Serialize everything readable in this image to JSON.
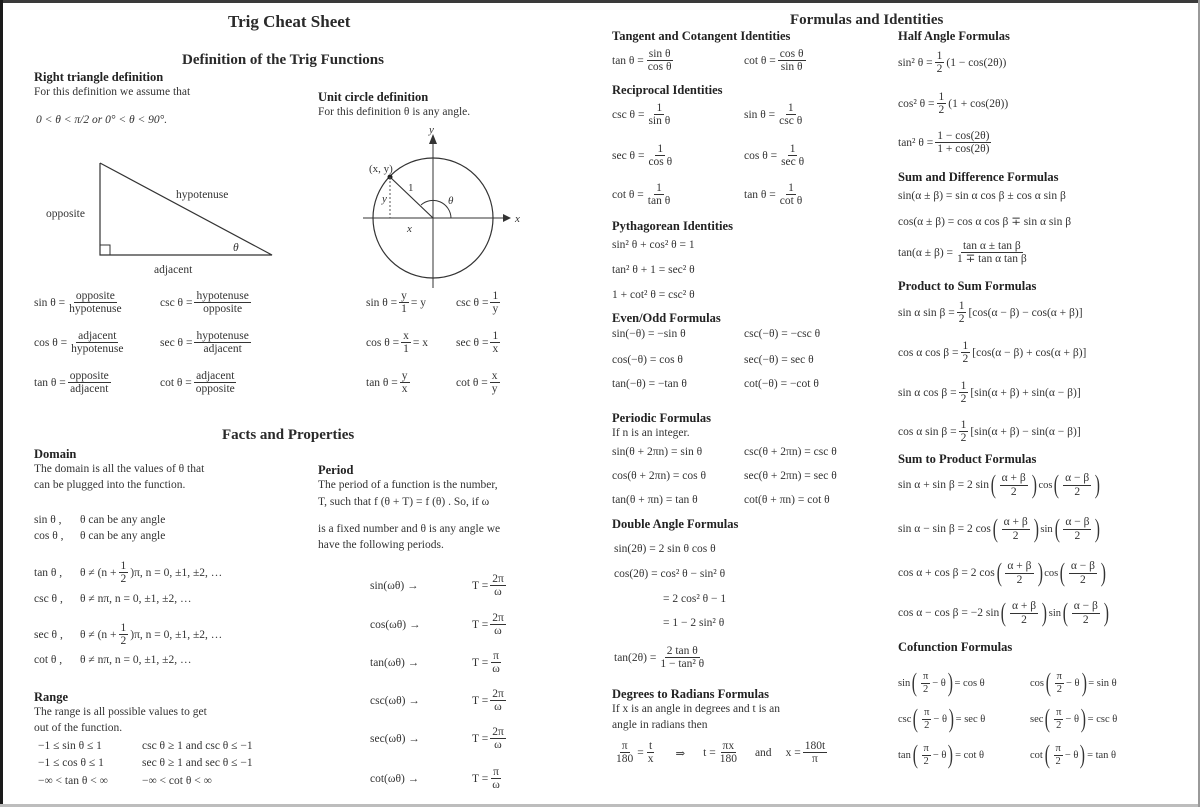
{
  "page": {
    "title": "Trig Cheat Sheet",
    "right_title": "Formulas and Identities"
  },
  "definitions": {
    "heading": "Definition of the Trig Functions",
    "right_triangle": {
      "heading": "Right triangle definition",
      "intro": "For this definition we assume that",
      "assumption": "0 < θ < π/2 or 0° < θ < 90°.",
      "labels": {
        "hypotenuse": "hypotenuse",
        "opposite": "opposite",
        "adjacent": "adjacent",
        "theta": "θ"
      },
      "formulas": [
        {
          "lhs": "sin θ =",
          "num": "opposite",
          "den": "hypotenuse"
        },
        {
          "lhs": "csc θ =",
          "num": "hypotenuse",
          "den": "opposite"
        },
        {
          "lhs": "cos θ =",
          "num": "adjacent",
          "den": "hypotenuse"
        },
        {
          "lhs": "sec θ =",
          "num": "hypotenuse",
          "den": "adjacent"
        },
        {
          "lhs": "tan θ =",
          "num": "opposite",
          "den": "adjacent"
        },
        {
          "lhs": "cot θ =",
          "num": "adjacent",
          "den": "opposite"
        }
      ]
    },
    "unit_circle": {
      "heading": "Unit circle definition",
      "intro": "For this definition θ is any angle.",
      "labels": {
        "point": "(x, y)",
        "radius": "1",
        "x": "x",
        "y": "y",
        "theta": "θ"
      },
      "formulas": [
        {
          "lhs": "sin θ =",
          "num": "y",
          "den": "1",
          "tail": "= y"
        },
        {
          "lhs": "csc θ =",
          "num": "1",
          "den": "y",
          "tail": ""
        },
        {
          "lhs": "cos θ =",
          "num": "x",
          "den": "1",
          "tail": "= x"
        },
        {
          "lhs": "sec θ =",
          "num": "1",
          "den": "x",
          "tail": ""
        },
        {
          "lhs": "tan θ =",
          "num": "y",
          "den": "x",
          "tail": ""
        },
        {
          "lhs": "cot θ =",
          "num": "x",
          "den": "y",
          "tail": ""
        }
      ]
    }
  },
  "facts": {
    "heading": "Facts and Properties",
    "domain": {
      "heading": "Domain",
      "text1": "The domain is all the values of θ that",
      "text2": "can be plugged into the function.",
      "rows": [
        {
          "fn": "sin θ ,",
          "cond": "θ can be any angle"
        },
        {
          "fn": "cos θ ,",
          "cond": "θ can be any angle"
        },
        {
          "fn": "tan θ ,",
          "cond_pre": "θ ≠ (n + ",
          "cond_num": "1",
          "cond_den": "2",
          "cond_post": ")π,  n = 0, ±1, ±2, …"
        },
        {
          "fn": "csc θ ,",
          "cond": "θ ≠ nπ,  n = 0, ±1, ±2, …"
        },
        {
          "fn": "sec θ ,",
          "cond_pre": "θ ≠ (n + ",
          "cond_num": "1",
          "cond_den": "2",
          "cond_post": ")π,  n = 0, ±1, ±2, …"
        },
        {
          "fn": "cot θ ,",
          "cond": "θ ≠ nπ,  n = 0, ±1, ±2, …"
        }
      ]
    },
    "range": {
      "heading": "Range",
      "text1": "The range is all possible values to get",
      "text2": "out of the function.",
      "rows": [
        {
          "a": "−1 ≤ sin θ ≤ 1",
          "b": "csc θ ≥ 1 and csc θ ≤ −1"
        },
        {
          "a": "−1 ≤ cos θ ≤ 1",
          "b": "sec θ ≥ 1 and sec θ ≤ −1"
        },
        {
          "a": "−∞ < tan θ < ∞",
          "b": "−∞ < cot θ < ∞"
        }
      ]
    },
    "period": {
      "heading": "Period",
      "text1": "The period of a function is the number,",
      "text2": "T, such that f (θ + T) = f (θ) .  So, if ω",
      "text3": "is a fixed number and θ is any angle we",
      "text4": "have the following periods.",
      "rows": [
        {
          "fn": "sin(ωθ)  →",
          "lhs": "T =",
          "num": "2π",
          "den": "ω"
        },
        {
          "fn": "cos(ωθ)  →",
          "lhs": "T =",
          "num": "2π",
          "den": "ω"
        },
        {
          "fn": "tan(ωθ)  →",
          "lhs": "T =",
          "num": "π",
          "den": "ω"
        },
        {
          "fn": "csc(ωθ)  →",
          "lhs": "T =",
          "num": "2π",
          "den": "ω"
        },
        {
          "fn": "sec(ωθ)  →",
          "lhs": "T =",
          "num": "2π",
          "den": "ω"
        },
        {
          "fn": "cot(ωθ)  →",
          "lhs": "T =",
          "num": "π",
          "den": "ω"
        }
      ]
    }
  },
  "identities": {
    "tan_cot": {
      "heading": "Tangent and Cotangent Identities",
      "items": [
        {
          "lhs": "tan θ =",
          "num": "sin θ",
          "den": "cos θ"
        },
        {
          "lhs": "cot θ =",
          "num": "cos θ",
          "den": "sin θ"
        }
      ]
    },
    "reciprocal": {
      "heading": "Reciprocal Identities",
      "items": [
        {
          "lhs": "csc θ =",
          "num": "1",
          "den": "sin θ"
        },
        {
          "lhs": "sin θ =",
          "num": "1",
          "den": "csc θ"
        },
        {
          "lhs": "sec θ =",
          "num": "1",
          "den": "cos θ"
        },
        {
          "lhs": "cos θ =",
          "num": "1",
          "den": "sec θ"
        },
        {
          "lhs": "cot θ =",
          "num": "1",
          "den": "tan θ"
        },
        {
          "lhs": "tan θ =",
          "num": "1",
          "den": "cot θ"
        }
      ]
    },
    "pythagorean": {
      "heading": "Pythagorean Identities",
      "items": [
        "sin² θ + cos² θ = 1",
        "tan² θ + 1 = sec² θ",
        "1 + cot² θ = csc² θ"
      ]
    },
    "even_odd": {
      "heading": "Even/Odd Formulas",
      "items": [
        "sin(−θ) = −sin θ",
        "csc(−θ) = −csc θ",
        "cos(−θ) = cos θ",
        "sec(−θ) = sec θ",
        "tan(−θ) = −tan θ",
        "cot(−θ) = −cot θ"
      ]
    },
    "periodic": {
      "heading": "Periodic Formulas",
      "intro": "If n is an integer.",
      "items": [
        "sin(θ + 2πn) = sin θ",
        "csc(θ + 2πn) = csc θ",
        "cos(θ + 2πn) = cos θ",
        "sec(θ + 2πn) = sec θ",
        "tan(θ + πn) = tan θ",
        "cot(θ + πn) = cot θ"
      ]
    },
    "double_angle": {
      "heading": "Double Angle Formulas",
      "items": [
        "sin(2θ) = 2 sin θ cos θ",
        "cos(2θ) = cos² θ − sin² θ",
        "= 2 cos² θ − 1",
        "= 1 − 2 sin² θ"
      ],
      "tan": {
        "lhs": "tan(2θ) =",
        "num": "2 tan θ",
        "den": "1 − tan² θ"
      }
    },
    "deg_rad": {
      "heading": "Degrees to Radians Formulas",
      "text1": "If x is an angle in degrees and t is an",
      "text2": "angle in radians then",
      "f1": {
        "num": "π",
        "den": "180"
      },
      "eq": "=",
      "f2": {
        "num": "t",
        "den": "x"
      },
      "implies": "⇒",
      "t_lhs": "t =",
      "f3": {
        "num": "πx",
        "den": "180"
      },
      "and": "and",
      "x_lhs": "x =",
      "f4": {
        "num": "180t",
        "den": "π"
      }
    },
    "half_angle": {
      "heading": "Half Angle Formulas",
      "items": [
        {
          "lhs": "sin² θ =",
          "num": "1",
          "den": "2",
          "tail": "(1 − cos(2θ))"
        },
        {
          "lhs": "cos² θ =",
          "num": "1",
          "den": "2",
          "tail": "(1 + cos(2θ))"
        }
      ],
      "tan": {
        "lhs": "tan² θ =",
        "num": "1 − cos(2θ)",
        "den": "1 + cos(2θ)"
      }
    },
    "sum_diff": {
      "heading": "Sum and Difference Formulas",
      "items": [
        "sin(α ± β) = sin α cos β ± cos α sin β",
        "cos(α ± β) = cos α cos β ∓ sin α sin β"
      ],
      "tan": {
        "lhs": "tan(α ± β) =",
        "num": "tan α ± tan β",
        "den": "1 ∓ tan α tan β"
      }
    },
    "product_sum": {
      "heading": "Product to Sum Formulas",
      "items": [
        {
          "lhs": "sin α sin β =",
          "tail": "[cos(α − β) − cos(α + β)]"
        },
        {
          "lhs": "cos α cos β =",
          "tail": "[cos(α − β) + cos(α + β)]"
        },
        {
          "lhs": "sin α cos β =",
          "tail": "[sin(α + β) + sin(α − β)]"
        },
        {
          "lhs": "cos α sin β =",
          "tail": "[sin(α + β) − sin(α − β)]"
        }
      ],
      "half_num": "1",
      "half_den": "2"
    },
    "sum_product": {
      "heading": "Sum to Product Formulas",
      "items": [
        {
          "lhs": "sin α + sin β = 2 sin",
          "mid": "cos"
        },
        {
          "lhs": "sin α − sin β = 2 cos",
          "mid": "sin"
        },
        {
          "lhs": "cos α + cos β = 2 cos",
          "mid": "cos"
        },
        {
          "lhs": "cos α − cos β = −2 sin",
          "mid": "sin"
        }
      ],
      "plus_num": "α + β",
      "minus_num": "α − β",
      "den": "2"
    },
    "cofunction": {
      "heading": "Cofunction Formulas",
      "items": [
        {
          "fn": "sin",
          "rhs": "= cos θ"
        },
        {
          "fn": "cos",
          "rhs": "= sin θ"
        },
        {
          "fn": "csc",
          "rhs": "= sec θ"
        },
        {
          "fn": "sec",
          "rhs": "= csc θ"
        },
        {
          "fn": "tan",
          "rhs": "= cot θ"
        },
        {
          "fn": "cot",
          "rhs": "= tan θ"
        }
      ],
      "num": "π",
      "den": "2",
      "minus": "− θ"
    }
  }
}
